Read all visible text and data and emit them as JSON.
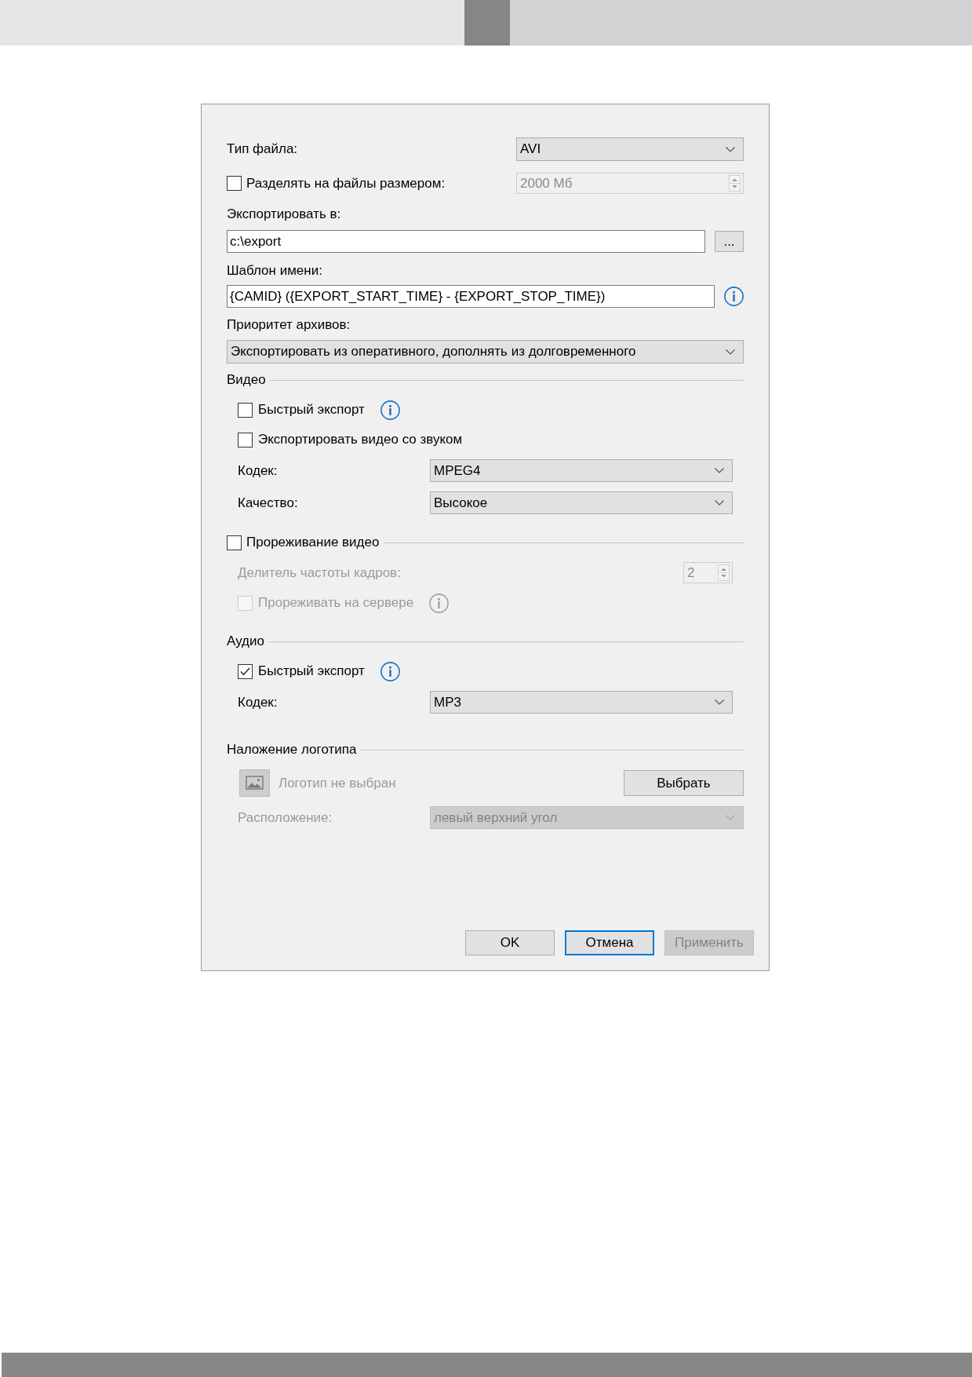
{
  "dialog": {
    "file_type": {
      "label": "Тип файла:",
      "value": "AVI"
    },
    "split_files": {
      "label": "Разделять на файлы размером:",
      "checked": false,
      "value": "2000 Мб",
      "disabled": true
    },
    "export_to": {
      "label": "Экспортировать в:",
      "value": "c:\\export",
      "browse_button": "..."
    },
    "name_template": {
      "label": "Шаблон имени:",
      "value": "{CAMID} ({EXPORT_START_TIME} - {EXPORT_STOP_TIME})"
    },
    "archive_priority": {
      "label": "Приоритет архивов:",
      "value": "Экспортировать из оперативного, дополнять из долговременного"
    }
  },
  "sections": [
    {
      "kind": "plain",
      "title": "Видео",
      "rows": [
        {
          "kind": "checkbox",
          "label": "Быстрый экспорт",
          "checked": false,
          "disabled": false,
          "info": true
        },
        {
          "kind": "checkbox",
          "label": "Экспортировать видео со звуком",
          "checked": false,
          "disabled": false,
          "info": false
        },
        {
          "kind": "combo",
          "label": "Кодек:",
          "value": "MPEG4",
          "disabled": false
        },
        {
          "kind": "combo",
          "label": "Качество:",
          "value": "Высокое",
          "disabled": false
        }
      ]
    },
    {
      "kind": "checkable",
      "title": "Прореживание видео",
      "checked": false,
      "rows": [
        {
          "kind": "spin",
          "label": "Делитель частоты кадров:",
          "value": "2",
          "disabled": true
        },
        {
          "kind": "checkbox",
          "label": "Прореживать на сервере",
          "checked": false,
          "disabled": true,
          "info": true
        }
      ]
    },
    {
      "kind": "plain",
      "title": "Аудио",
      "rows": [
        {
          "kind": "checkbox",
          "label": "Быстрый экспорт",
          "checked": true,
          "disabled": false,
          "info": true
        },
        {
          "kind": "combo",
          "label": "Кодек:",
          "value": "MP3",
          "disabled": false
        }
      ]
    },
    {
      "kind": "plain",
      "title": "Наложение логотипа",
      "rows": [
        {
          "kind": "logo",
          "label": "Логотип не выбран",
          "button": "Выбрать",
          "disabled": true
        },
        {
          "kind": "combo",
          "label": "Расположение:",
          "value": "левый верхний угол",
          "disabled": true
        }
      ]
    }
  ],
  "buttons": [
    {
      "label": "OK",
      "focused": false,
      "disabled": false
    },
    {
      "label": "Отмена",
      "focused": true,
      "disabled": false
    },
    {
      "label": "Применить",
      "focused": false,
      "disabled": true
    }
  ]
}
